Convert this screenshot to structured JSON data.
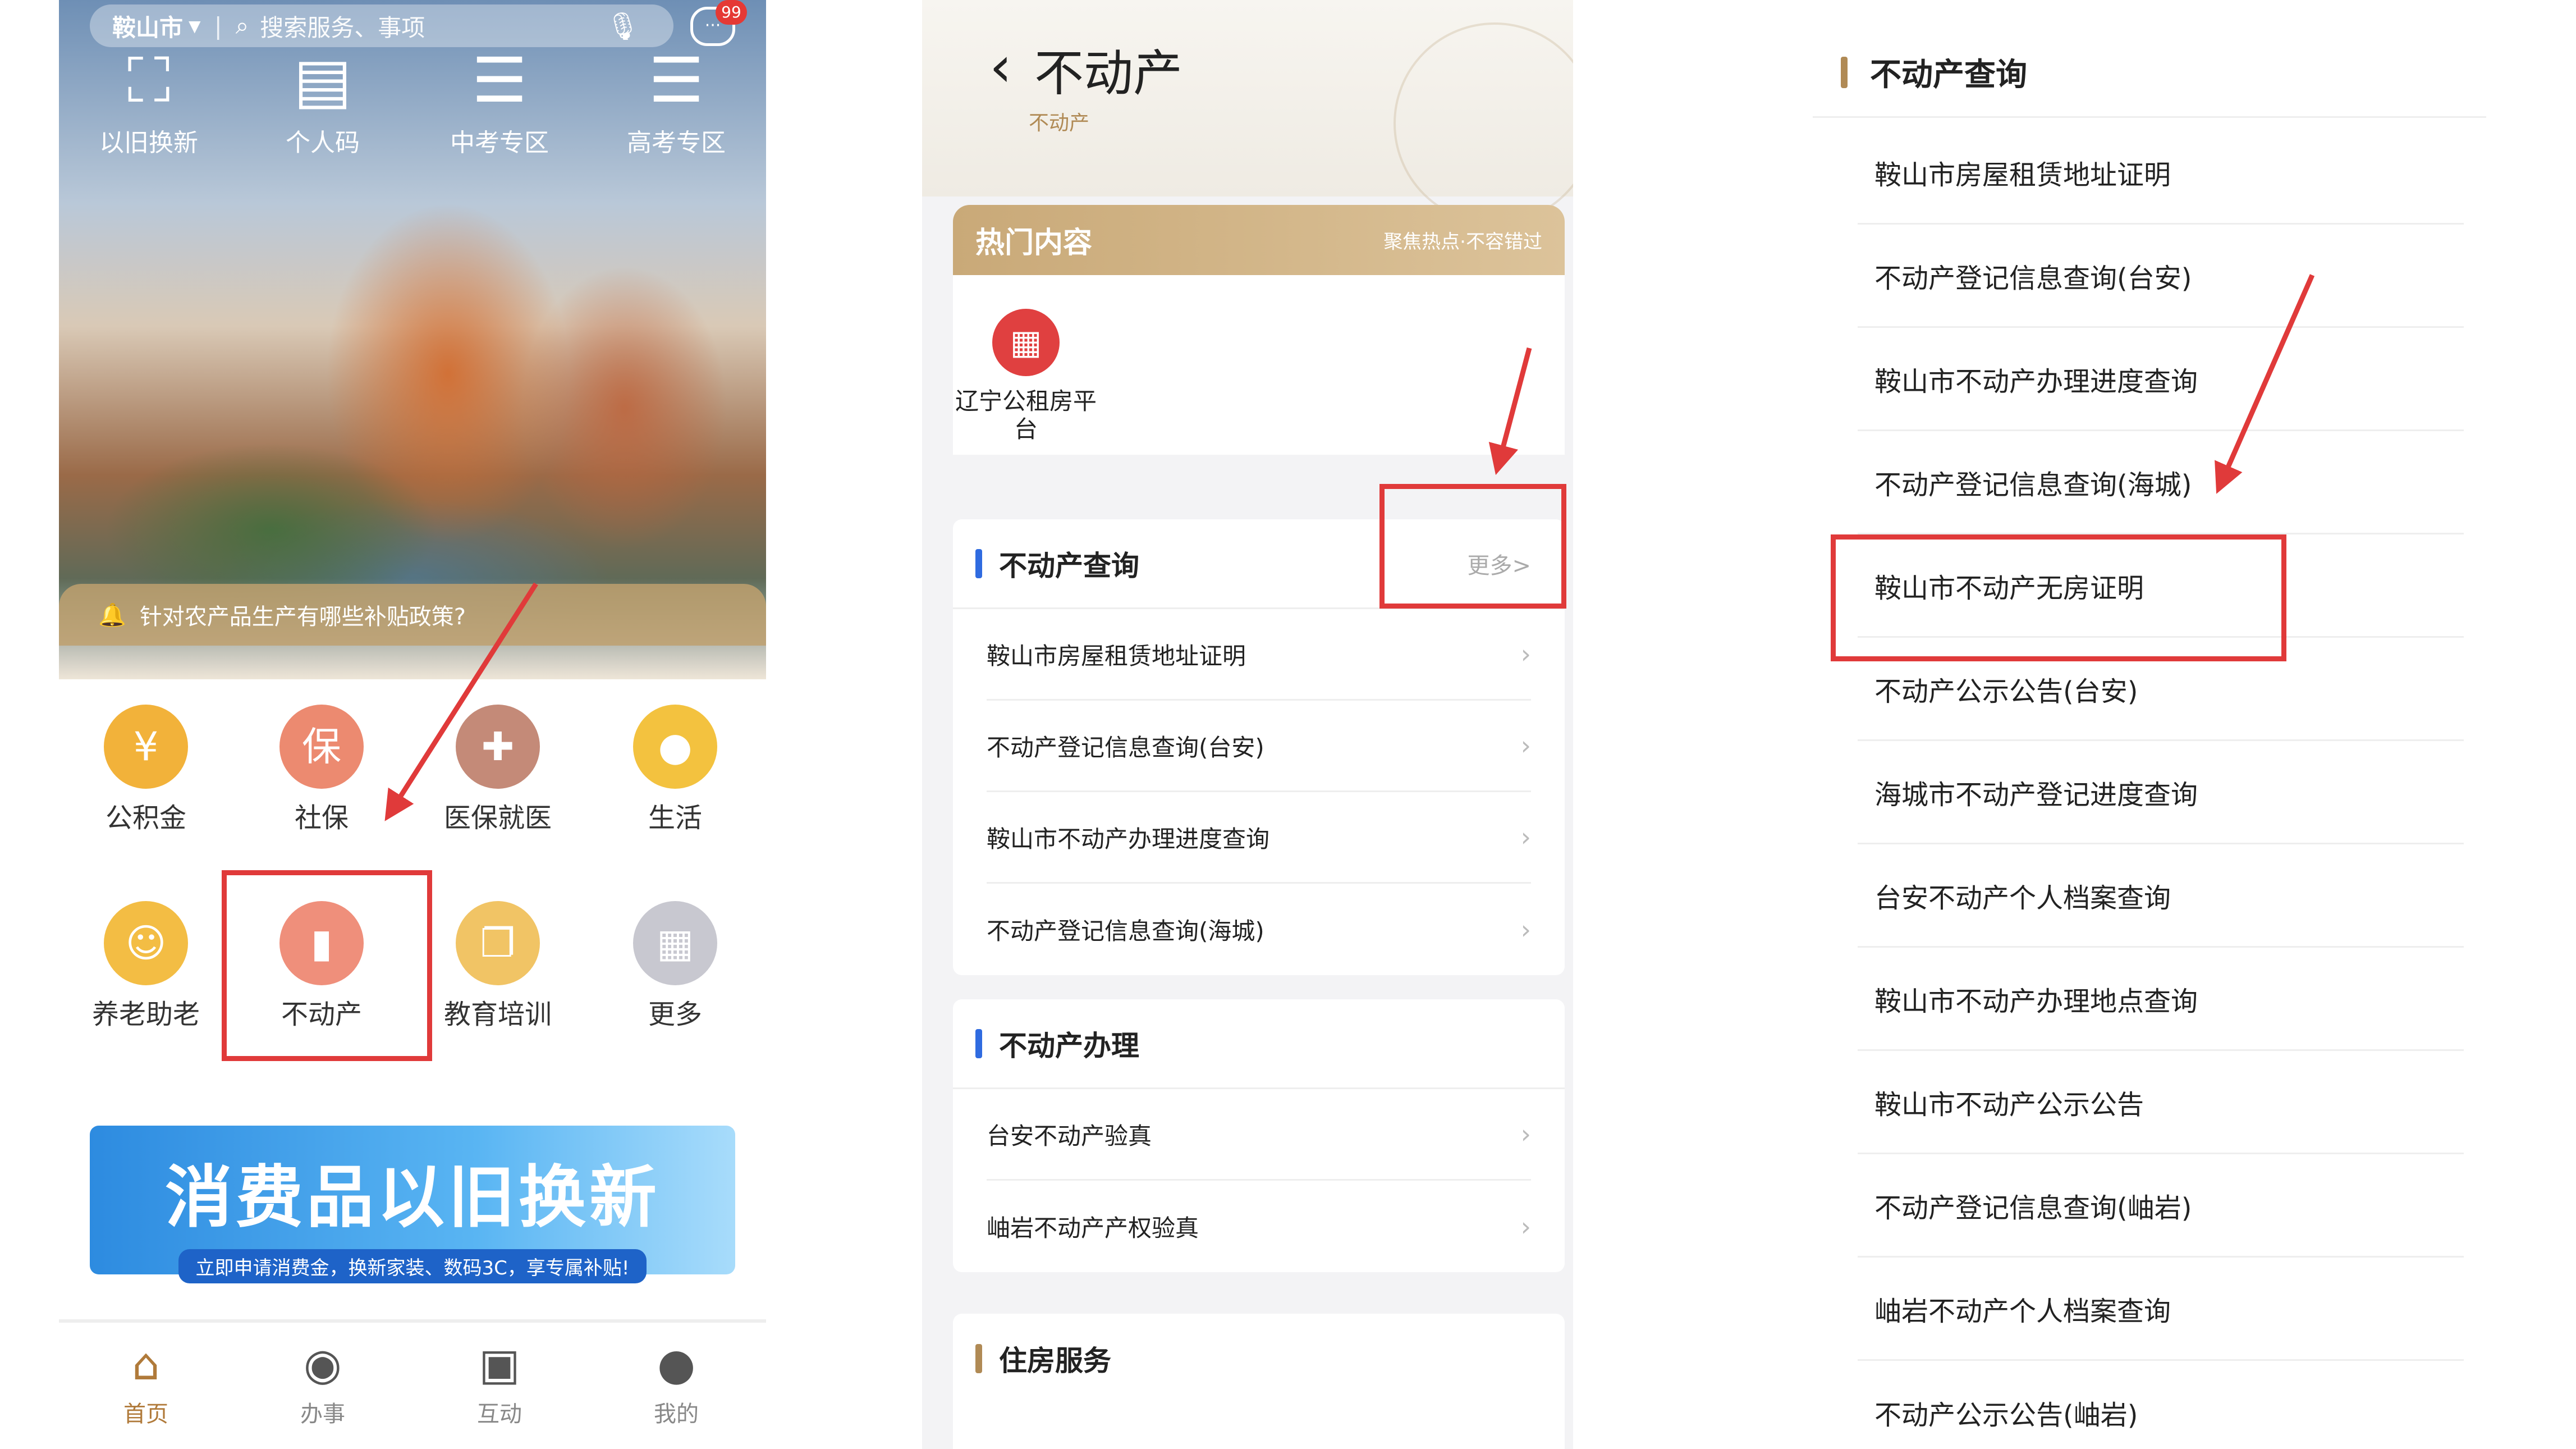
{
  "panel1": {
    "search": {
      "city": "鞍山市",
      "placeholder": "搜索服务、事项"
    },
    "badge": "99",
    "top_icons": [
      {
        "label": "以旧换新",
        "icon": "scan-icon",
        "glyph": "⛶"
      },
      {
        "label": "个人码",
        "icon": "id-card-icon",
        "glyph": "▤"
      },
      {
        "label": "中考专区",
        "icon": "stack-icon",
        "glyph": "☰"
      },
      {
        "label": "高考专区",
        "icon": "stack-icon",
        "glyph": "☰"
      }
    ],
    "notice": "针对农产品生产有哪些补贴政策?",
    "grid": [
      {
        "label": "公积金",
        "icon": "house-yen-icon",
        "glyph": "¥",
        "color": "#f2b23a"
      },
      {
        "label": "社保",
        "icon": "insurance-icon",
        "glyph": "保",
        "color": "#ec8a70"
      },
      {
        "label": "医保就医",
        "icon": "medical-icon",
        "glyph": "✚",
        "color": "#c48a78"
      },
      {
        "label": "生活",
        "icon": "shield-icon",
        "glyph": "●",
        "color": "#f3c23f"
      },
      {
        "label": "养老助老",
        "icon": "elderly-icon",
        "glyph": "☺",
        "color": "#f3bd44"
      },
      {
        "label": "不动产",
        "icon": "building-icon",
        "glyph": "▮",
        "color": "#ef8f7b"
      },
      {
        "label": "教育培训",
        "icon": "book-icon",
        "glyph": "❐",
        "color": "#f1c465"
      },
      {
        "label": "更多",
        "icon": "grid-icon",
        "glyph": "▦",
        "color": "#c8c8d0"
      }
    ],
    "banner": {
      "title": "消费品以旧换新",
      "subtitle": "立即申请消费金，换新家装、数码3C，享专属补贴!"
    },
    "tabs": [
      {
        "label": "首页",
        "icon": "home-icon",
        "glyph": "⌂"
      },
      {
        "label": "办事",
        "icon": "compass-icon",
        "glyph": "◉"
      },
      {
        "label": "互动",
        "icon": "chat-icon",
        "glyph": "▣"
      },
      {
        "label": "我的",
        "icon": "person-icon",
        "glyph": "●"
      }
    ]
  },
  "panel2": {
    "title": "不动产",
    "subtitle": "不动产",
    "hot": {
      "title": "热门内容",
      "tagline": "聚焦热点·不容错过",
      "item": "辽宁公租房平台"
    },
    "query": {
      "title": "不动产查询",
      "more": "更多>",
      "rows": [
        "鞍山市房屋租赁地址证明",
        "不动产登记信息查询(台安)",
        "鞍山市不动产办理进度查询",
        "不动产登记信息查询(海城)"
      ]
    },
    "handle": {
      "title": "不动产办理",
      "rows": [
        "台安不动产验真",
        "岫岩不动产产权验真"
      ]
    },
    "housing": {
      "title": "住房服务"
    }
  },
  "panel3": {
    "title": "不动产查询",
    "rows": [
      "鞍山市房屋租赁地址证明",
      "不动产登记信息查询(台安)",
      "鞍山市不动产办理进度查询",
      "不动产登记信息查询(海城)",
      "鞍山市不动产无房证明",
      "不动产公示公告(台安)",
      "海城市不动产登记进度查询",
      "台安不动产个人档案查询",
      "鞍山市不动产办理地点查询",
      "鞍山市不动产公示公告",
      "不动产登记信息查询(岫岩)",
      "岫岩不动产个人档案查询",
      "不动产公示公告(岫岩)"
    ]
  }
}
